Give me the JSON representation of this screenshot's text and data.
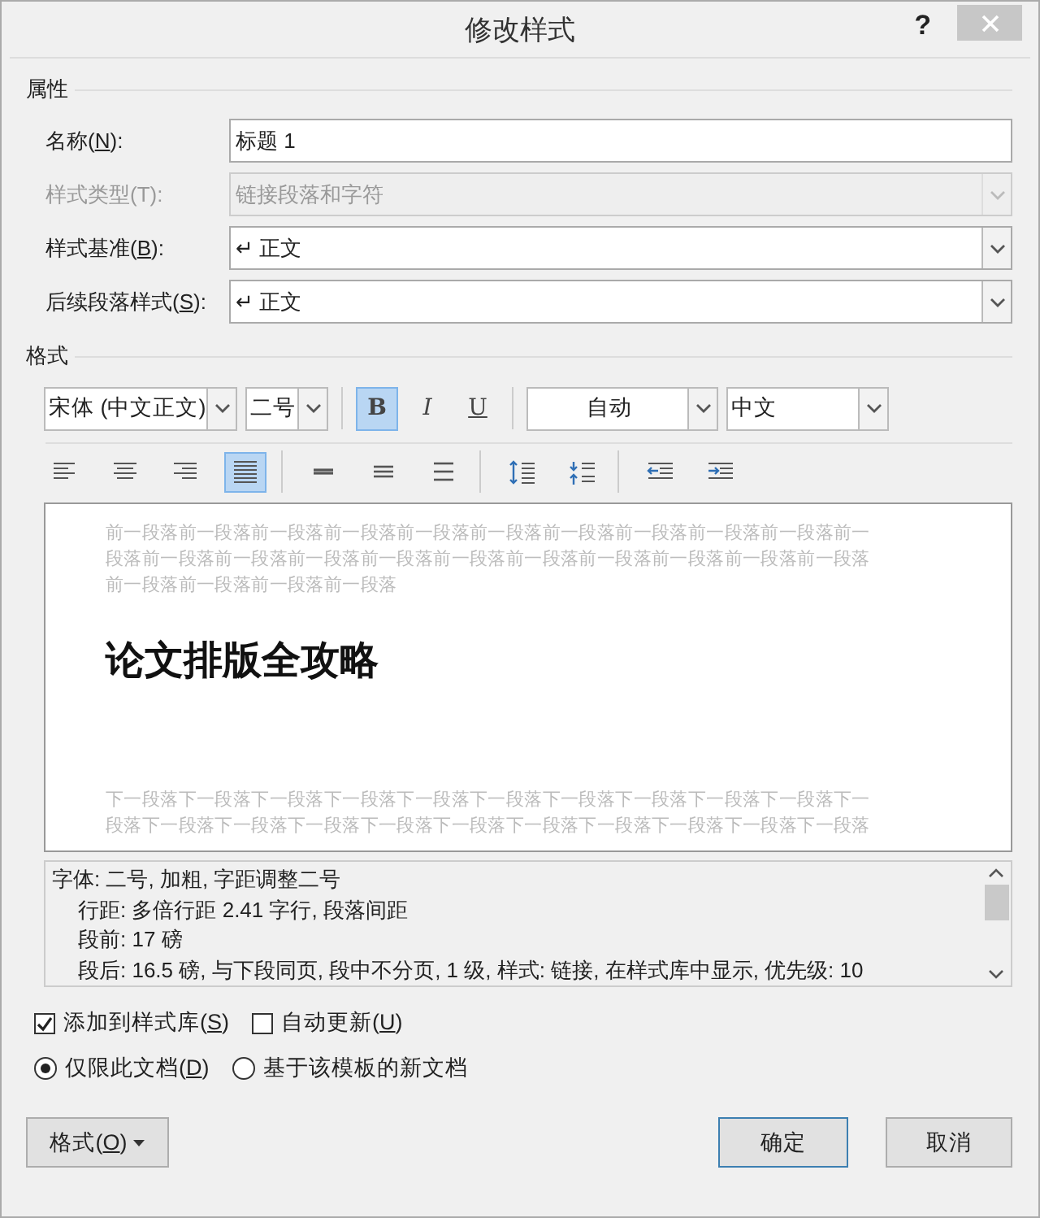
{
  "window": {
    "title": "修改样式",
    "help": "?"
  },
  "properties": {
    "heading": "属性",
    "fields": [
      {
        "label": "名称(",
        "key": "N",
        "suffix": "):",
        "value": "标题 1",
        "kind": "text",
        "disabled": false
      },
      {
        "label": "样式类型(T):",
        "value": "链接段落和字符",
        "kind": "select",
        "disabled": true
      },
      {
        "label": "样式基准(",
        "key": "B",
        "suffix": "):",
        "value": "↵ 正文",
        "kind": "select",
        "disabled": false
      },
      {
        "label": "后续段落样式(",
        "key": "S",
        "suffix": "):",
        "value": "↵ 正文",
        "kind": "select",
        "disabled": false
      }
    ]
  },
  "format": {
    "heading": "格式",
    "font": "宋体 (中文正文)",
    "size": "二号",
    "styles": [
      {
        "label": "B",
        "kind": "bold",
        "selected": true
      },
      {
        "label": "I",
        "kind": "italic",
        "selected": false
      },
      {
        "label": "U",
        "kind": "underline",
        "selected": false
      }
    ],
    "font_color": "自动",
    "script": "中文",
    "paragraph_tools": [
      [
        {
          "kind": "align-left",
          "selected": false
        },
        {
          "kind": "align-center",
          "selected": false
        },
        {
          "kind": "align-right",
          "selected": false
        },
        {
          "kind": "justify",
          "selected": true
        }
      ],
      [
        {
          "kind": "single-spacing",
          "selected": false
        },
        {
          "kind": "one-half-spacing",
          "selected": false
        },
        {
          "kind": "double-spacing",
          "selected": false
        }
      ],
      [
        {
          "kind": "increase-spacing",
          "selected": false
        },
        {
          "kind": "decrease-spacing",
          "selected": false
        }
      ],
      [
        {
          "kind": "outdent",
          "selected": false
        },
        {
          "kind": "indent",
          "selected": false
        }
      ]
    ]
  },
  "preview": {
    "before_lines": [
      "前一段落前一段落前一段落前一段落前一段落前一段落前一段落前一段落前一段落前一段落前一",
      "段落前一段落前一段落前一段落前一段落前一段落前一段落前一段落前一段落前一段落前一段落",
      "前一段落前一段落前一段落前一段落"
    ],
    "heading": "论文排版全攻略",
    "after_lines": [
      "下一段落下一段落下一段落下一段落下一段落下一段落下一段落下一段落下一段落下一段落下一",
      "段落下一段落下一段落下一段落下一段落下一段落下一段落下一段落下一段落下一段落下一段落"
    ]
  },
  "description": [
    {
      "text": "字体: 二号, 加粗, 字距调整二号",
      "kind": "main"
    },
    {
      "text": "行距: 多倍行距 2.41 字行, 段落间距",
      "kind": "sub"
    },
    {
      "text": "段前: 17 磅",
      "kind": "sub"
    },
    {
      "text": "段后: 16.5 磅, 与下段同页, 段中不分页, 1 级, 样式: 链接, 在样式库中显示, 优先级: 10",
      "kind": "sub"
    }
  ],
  "checkboxes": [
    {
      "label": "添加到样式库(",
      "key": "S",
      "suffix": ")",
      "checked": true
    },
    {
      "label": "自动更新(",
      "key": "U",
      "suffix": ")",
      "checked": false
    }
  ],
  "radios": [
    {
      "label": "仅限此文档(",
      "key": "D",
      "suffix": ")",
      "selected": true
    },
    {
      "label": "基于该模板的新文档",
      "selected": false
    }
  ],
  "buttons": {
    "format": {
      "label": "格式(",
      "key": "O",
      "suffix": ")"
    },
    "ok": {
      "label": "确定",
      "default": true
    },
    "cancel": {
      "label": "取消",
      "default": false
    }
  }
}
